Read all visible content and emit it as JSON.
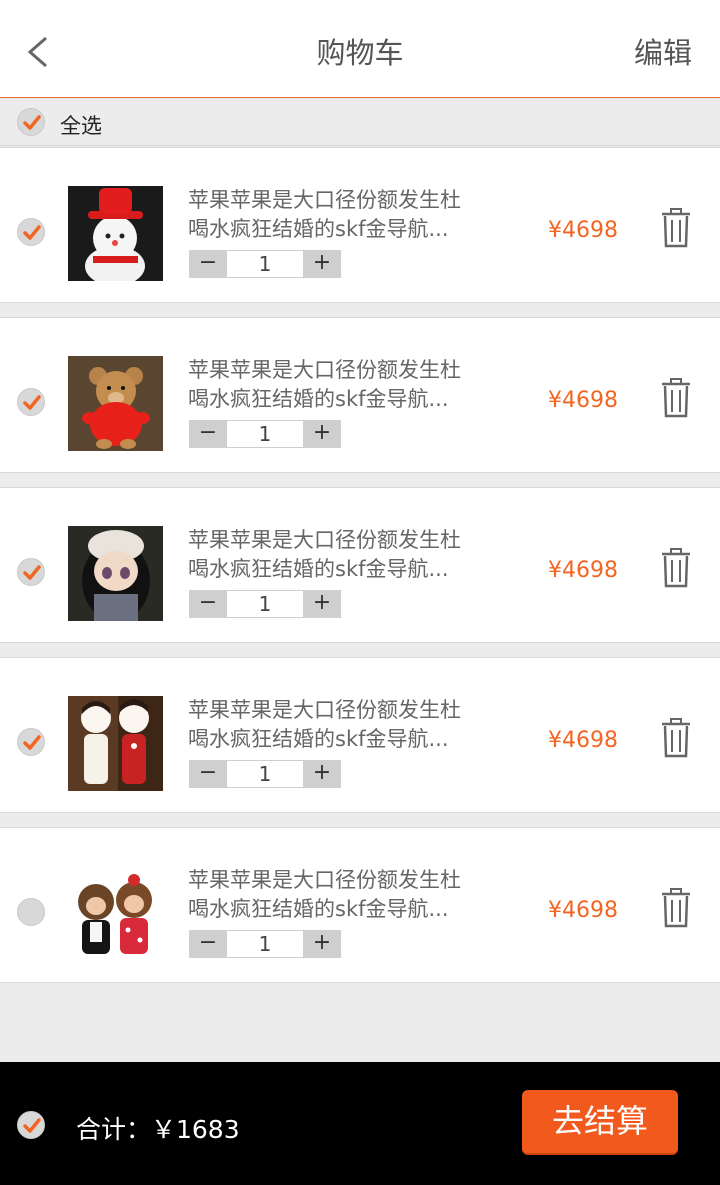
{
  "header": {
    "title": "购物车",
    "edit_label": "编辑"
  },
  "select_all": {
    "label": "全选",
    "checked": true
  },
  "items": [
    {
      "line1": "苹果苹果是大口径份额发生杜",
      "line2": "喝水疯狂结婚的skf金导航...",
      "qty": "1",
      "price": "¥4698",
      "checked": true,
      "image": "snowman-toy"
    },
    {
      "line1": "苹果苹果是大口径份额发生杜",
      "line2": "喝水疯狂结婚的skf金导航...",
      "qty": "1",
      "price": "¥4698",
      "checked": true,
      "image": "teddy-bear"
    },
    {
      "line1": "苹果苹果是大口径份额发生杜",
      "line2": "喝水疯狂结婚的skf金导航...",
      "qty": "1",
      "price": "¥4698",
      "checked": true,
      "image": "doll-knit-hat"
    },
    {
      "line1": "苹果苹果是大口径份额发生杜",
      "line2": "喝水疯狂结婚的skf金导航...",
      "qty": "1",
      "price": "¥4698",
      "checked": true,
      "image": "couple-dolls"
    },
    {
      "line1": "苹果苹果是大口径份额发生杜",
      "line2": "喝水疯狂结婚的skf金导航...",
      "qty": "1",
      "price": "¥4698",
      "checked": false,
      "image": "monchhichi-dolls"
    }
  ],
  "stepper": {
    "minus": "−",
    "plus": "+"
  },
  "footer": {
    "total_label": "合计：￥1683",
    "checkout_label": "去结算",
    "checked": true
  },
  "colors": {
    "accent": "#f15a1c",
    "price": "#f26522",
    "check": "#f26522"
  }
}
